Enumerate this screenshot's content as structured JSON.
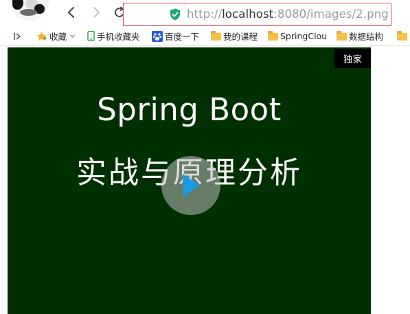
{
  "browser": {
    "address_bar": {
      "url_scheme": "http://",
      "url_host": "localhost",
      "url_rest": ":8080/images/2.png"
    }
  },
  "bookmarks": {
    "items": [
      {
        "label": "收藏",
        "icon": "star-icon"
      },
      {
        "label": "手机收藏夹",
        "icon": "phone-icon"
      },
      {
        "label": "百度一下",
        "icon": "baidu-paw-icon"
      },
      {
        "label": "我的课程",
        "icon": "folder-icon"
      },
      {
        "label": "SpringClou",
        "icon": "folder-icon"
      },
      {
        "label": "数据结构",
        "icon": "folder-icon"
      }
    ]
  },
  "video": {
    "badge": "独家",
    "title_line_1": "Spring Boot",
    "title_line_2": "实战与原理分析",
    "background_color": "#003000",
    "play_icon_color": "#1a9be6"
  },
  "colors": {
    "address_outline": "#d84a4a",
    "shield": "#1aa871"
  }
}
